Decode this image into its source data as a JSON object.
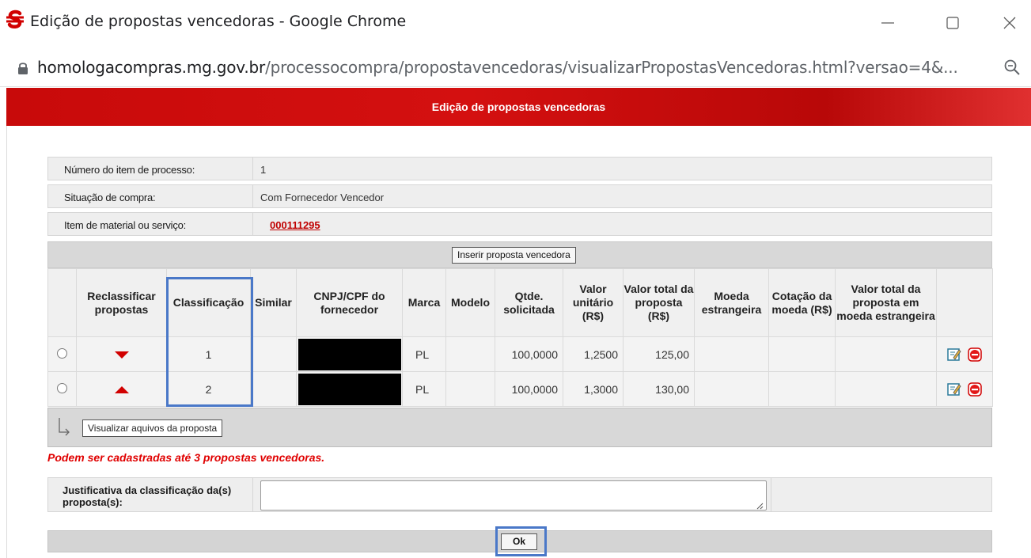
{
  "window": {
    "title": "Edição de propostas vencedoras - Google Chrome",
    "url_domain": "homologacompras.mg.gov.br",
    "url_path": "/processocompra/propostavencedoras/visualizarPropostasVencedoras.html?versao=4&..."
  },
  "header": {
    "title": "Edição de propostas vencedoras"
  },
  "info": {
    "item_label": "Número do item de processo:",
    "item_value": "1",
    "situacao_label": "Situação de compra:",
    "situacao_value": "Com Fornecedor Vencedor",
    "material_label": "Item de material ou serviço:",
    "material_value": "000111295"
  },
  "insert_button": "Inserir proposta vencedora",
  "table": {
    "headers": [
      "Reclassificar propostas",
      "Classificação",
      "Similar",
      "CNPJ/CPF do fornecedor",
      "Marca",
      "Modelo",
      "Qtde. solicitada",
      "Valor unitário (R$)",
      "Valor total da proposta (R$)",
      "Moeda estrangeira",
      "Cotação da moeda (R$)",
      "Valor total da proposta em moeda estrangeira"
    ],
    "rows": [
      {
        "classificacao": "1",
        "marca": "PL",
        "qtde": "100,0000",
        "valor_unitario": "1,2500",
        "valor_total": "125,00"
      },
      {
        "classificacao": "2",
        "marca": "PL",
        "qtde": "100,0000",
        "valor_unitario": "1,3000",
        "valor_total": "130,00"
      }
    ]
  },
  "files_button": "Visualizar aquivos da proposta",
  "warning": "Podem ser cadastradas até 3 propostas vencedoras.",
  "justification": {
    "label": "Justificativa da classificação da(s) proposta(s):",
    "value": ""
  },
  "ok_button": "Ok",
  "colors": {
    "brand_red": "#d10000",
    "highlight_blue": "#4a78c8"
  }
}
